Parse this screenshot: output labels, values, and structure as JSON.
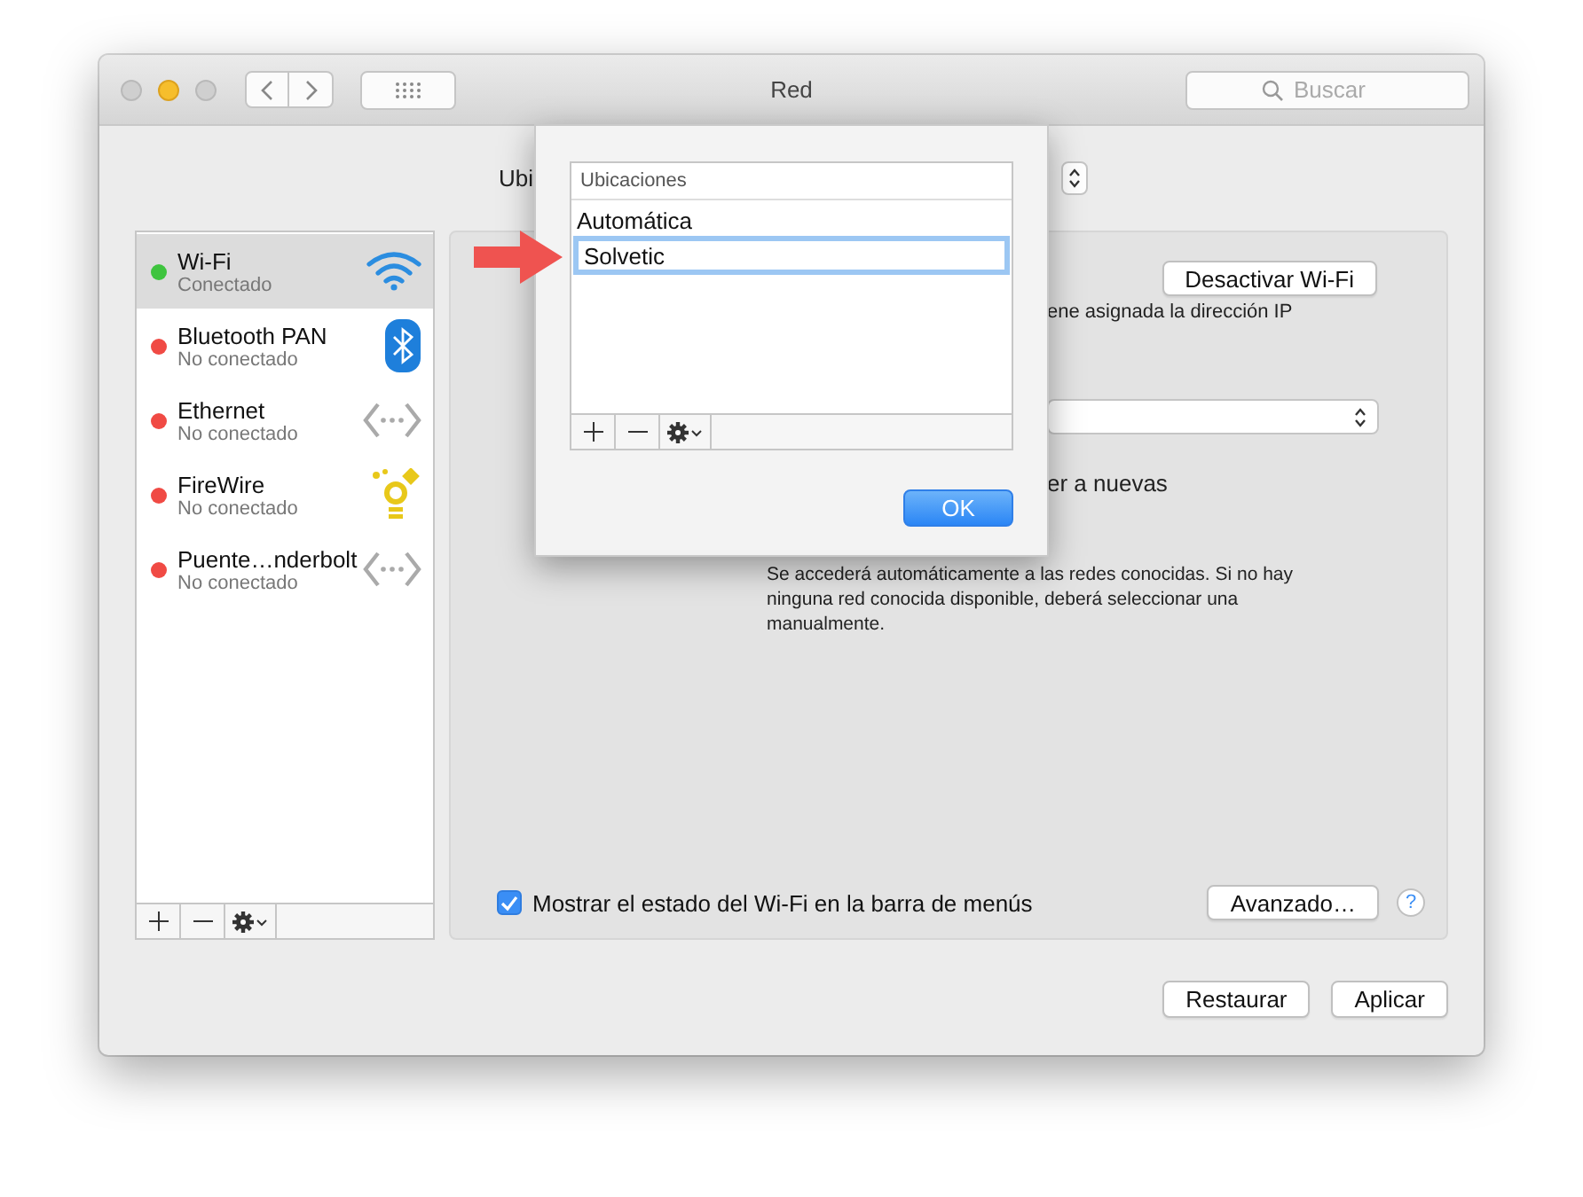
{
  "window": {
    "title": "Red",
    "search": {
      "placeholder": "Buscar"
    }
  },
  "location": {
    "label": "Ubi"
  },
  "services": [
    {
      "name": "Wi-Fi",
      "status": "Conectado",
      "connected": true,
      "selected": true,
      "kind": "wifi"
    },
    {
      "name": "Bluetooth PAN",
      "status": "No conectado",
      "connected": false,
      "selected": false,
      "kind": "bluetooth"
    },
    {
      "name": "Ethernet",
      "status": "No conectado",
      "connected": false,
      "selected": false,
      "kind": "ethernet"
    },
    {
      "name": "FireWire",
      "status": "No conectado",
      "connected": false,
      "selected": false,
      "kind": "firewire"
    },
    {
      "name": "Puente…nderbolt",
      "status": "No conectado",
      "connected": false,
      "selected": false,
      "kind": "ethernet"
    }
  ],
  "detail": {
    "toggle_button": "Desactivar Wi-Fi",
    "status_fragment": "ene asignada la dirección IP",
    "option_fragment": "er a nuevas",
    "note": "Se accederá automáticamente a las redes conocidas. Si no hay ninguna red conocida disponible, deberá seleccionar una manualmente.",
    "show_in_menu_bar": {
      "label": "Mostrar el estado del Wi-Fi en la barra de menús",
      "checked": true
    },
    "advanced_button": "Avanzado…",
    "help": "?"
  },
  "buttons": [
    {
      "label": "Restaurar"
    },
    {
      "label": "Aplicar"
    }
  ],
  "dialog": {
    "header": "Ubicaciones",
    "locations": [
      {
        "name": "Automática",
        "selected": false
      },
      {
        "name": "Solvetic",
        "selected": true
      }
    ],
    "ok_button": "OK"
  }
}
